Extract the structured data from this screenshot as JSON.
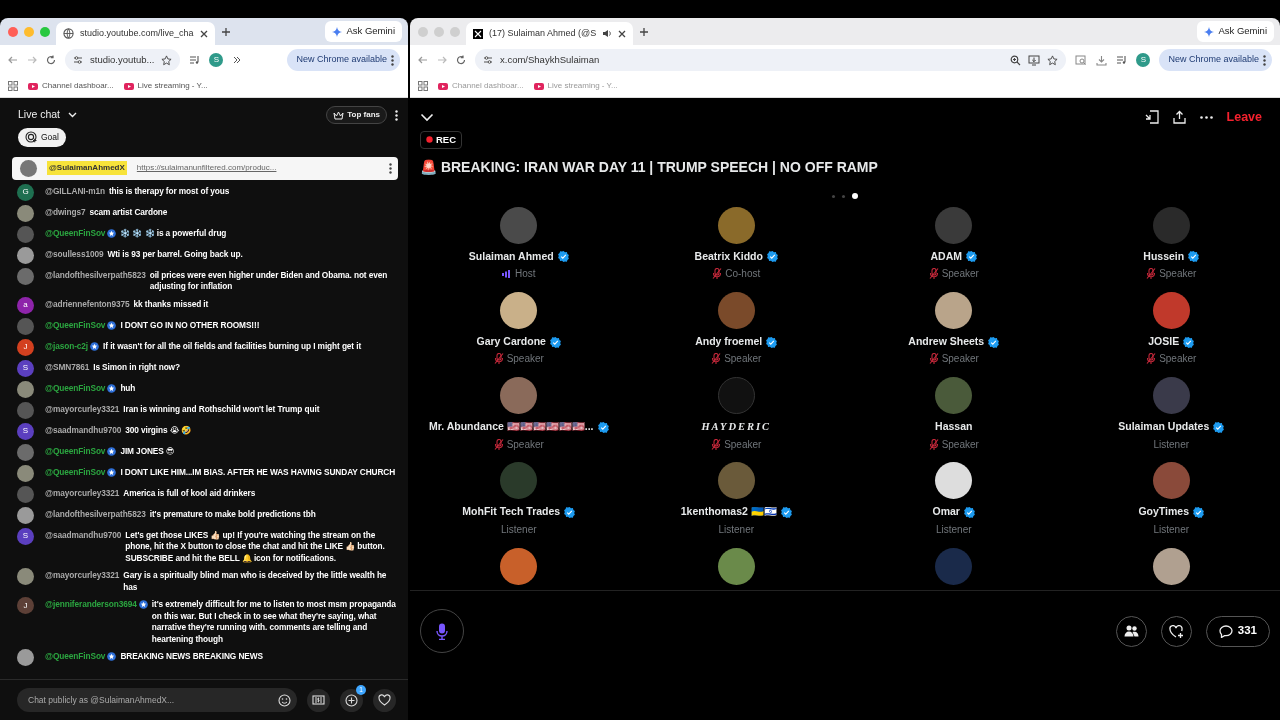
{
  "left_window": {
    "focused": true,
    "tab_title": "studio.youtube.com/live_cha",
    "address": "studio.youtub...",
    "profile_initial": "S",
    "update_button": "New Chrome available",
    "gemini_button": "Ask Gemini",
    "bookmarks": [
      "Channel dashboar...",
      "Live streaming - Y..."
    ],
    "chat": {
      "title": "Live chat",
      "top_fans": "Top fans",
      "goal": "Goal",
      "pinned": {
        "author": "@SulaimanAhmedX",
        "link": "https://sulaimanunfiltered.com/produc..."
      },
      "messages": [
        {
          "author": "@GILLANI-m1n",
          "member": false,
          "avatar_letter": "G",
          "color": "#1e6f50",
          "text": "this is therapy for most of yous"
        },
        {
          "author": "@dwings7",
          "member": false,
          "text": "scam artist Cardone"
        },
        {
          "author": "@QueenFinSov",
          "member": true,
          "text": "❄️ ❄️ ❄️ is a powerful drug"
        },
        {
          "author": "@soulless1009",
          "member": false,
          "text": "Wti is 93 per barrel. Going back up."
        },
        {
          "author": "@landofthesilverpath5823",
          "member": false,
          "text": "oil prices were even higher under Biden and Obama. not even adjusting for inflation"
        },
        {
          "author": "@adriennefenton9375",
          "member": false,
          "avatar_letter": "a",
          "color": "#8e24aa",
          "text": "kk thanks missed it"
        },
        {
          "author": "@QueenFinSov",
          "member": true,
          "text": "I DONT GO IN NO OTHER ROOMS!!!"
        },
        {
          "author": "@jason-c2j",
          "member": true,
          "avatar_letter": "J",
          "color": "#d3401f",
          "text": "If it wasn't for all the oil fields and facilities burning up I might get it"
        },
        {
          "author": "@SMN7861",
          "member": false,
          "avatar_letter": "S",
          "color": "#5b3fbf",
          "text": "Is Simon in right now?"
        },
        {
          "author": "@QueenFinSov",
          "member": true,
          "text": "huh"
        },
        {
          "author": "@mayorcurley3321",
          "member": false,
          "text": "Iran is winning and Rothschild won't let Trump quit"
        },
        {
          "author": "@saadmandhu9700",
          "member": false,
          "avatar_letter": "S",
          "color": "#5b3fbf",
          "text": "300 virgins 😭 🤣"
        },
        {
          "author": "@QueenFinSov",
          "member": true,
          "text": "JIM JONES 😎"
        },
        {
          "author": "@QueenFinSov",
          "member": true,
          "text": "I DONT LIKE HIM...IM BIAS. AFTER HE WAS HAVING SUNDAY CHURCH"
        },
        {
          "author": "@mayorcurley3321",
          "member": false,
          "text": "America is full of kool aid drinkers"
        },
        {
          "author": "@landofthesilverpath5823",
          "member": false,
          "text": "it's premature to make bold predictions tbh"
        },
        {
          "author": "@saadmandhu9700",
          "member": false,
          "avatar_letter": "S",
          "color": "#5b3fbf",
          "text": "Let's get those LIKES 👍🏻 up! If you're watching the stream on the phone, hit the X button to close the chat and hit the LIKE 👍🏻 button. SUBSCRIBE and hit the BELL 🔔 icon for notifications."
        },
        {
          "author": "@mayorcurley3321",
          "member": false,
          "text": "Gary is a spiritually blind man who is deceived by the little wealth he has"
        },
        {
          "author": "@jenniferanderson3694",
          "member": true,
          "avatar_letter": "J",
          "color": "#5d4037",
          "text": "it's extremely difficult for me to listen to most msm propaganda on this war. But I check in to see what they're saying, what narrative they're running with. comments are telling and heartening though"
        },
        {
          "author": "@QueenFinSov",
          "member": true,
          "text": "BREAKING NEWS BREAKING NEWS"
        }
      ],
      "input": {
        "placeholder": "Chat publicly as @SulaimanAhmedX...",
        "badge": "1"
      }
    }
  },
  "right_window": {
    "focused": false,
    "tab_title": "(17) Sulaiman Ahmed (@S",
    "address": "x.com/ShaykhSulaiman",
    "profile_initial": "S",
    "update_button": "New Chrome available",
    "gemini_button": "Ask Gemini",
    "bookmarks": [
      "Channel dashboar...",
      "Live streaming - Y..."
    ],
    "space": {
      "rec": "REC",
      "title": "🚨 BREAKING: IRAN WAR DAY 11 | TRUMP SPEECH | NO OFF RAMP",
      "leave": "Leave",
      "pages": [
        {
          "selected": false
        },
        {
          "selected": false
        },
        {
          "selected": true
        }
      ],
      "participants": [
        {
          "name": "Sulaiman Ahmed",
          "verified": true,
          "logo_name": false,
          "kind": "host",
          "role": "Host"
        },
        {
          "name": "Beatrix Kiddo",
          "verified": true,
          "logo_name": false,
          "kind": "speaker",
          "role": "Co-host"
        },
        {
          "name": "ADAM",
          "verified": true,
          "logo_name": false,
          "kind": "speaker",
          "role": "Speaker"
        },
        {
          "name": "Hussein",
          "verified": true,
          "logo_name": false,
          "kind": "speaker",
          "role": "Speaker"
        },
        {
          "name": "Gary Cardone",
          "verified": true,
          "logo_name": false,
          "kind": "speaker",
          "role": "Speaker"
        },
        {
          "name": "Andy froemel",
          "verified": true,
          "logo_name": false,
          "kind": "speaker",
          "role": "Speaker"
        },
        {
          "name": "Andrew Sheets",
          "verified": true,
          "logo_name": false,
          "kind": "speaker",
          "role": "Speaker"
        },
        {
          "name": "JOSIE",
          "verified": true,
          "logo_name": false,
          "kind": "speaker",
          "role": "Speaker"
        },
        {
          "name": "Mr. Abundance 🇺🇸🇺🇸🇺🇸🇺🇸🇺🇸🇺🇸...",
          "verified": true,
          "logo_name": false,
          "kind": "speaker",
          "role": "Speaker"
        },
        {
          "name": "HAYDERIC",
          "verified": false,
          "logo_name": true,
          "kind": "speaker",
          "role": "Speaker"
        },
        {
          "name": "Hassan",
          "verified": false,
          "logo_name": false,
          "kind": "speaker",
          "role": "Speaker"
        },
        {
          "name": "Sulaiman Updates",
          "verified": true,
          "logo_name": false,
          "kind": "listener",
          "role": "Listener"
        },
        {
          "name": "MohFit Tech Trades",
          "verified": true,
          "logo_name": false,
          "kind": "listener",
          "role": "Listener"
        },
        {
          "name": "1kenthomas2 🇺🇦🇮🇱",
          "verified": true,
          "logo_name": false,
          "kind": "listener",
          "role": "Listener"
        },
        {
          "name": "Omar",
          "verified": true,
          "logo_name": false,
          "kind": "listener",
          "role": "Listener"
        },
        {
          "name": "GoyTimes",
          "verified": true,
          "logo_name": false,
          "kind": "listener",
          "role": "Listener"
        }
      ],
      "comment_count": "331"
    }
  }
}
